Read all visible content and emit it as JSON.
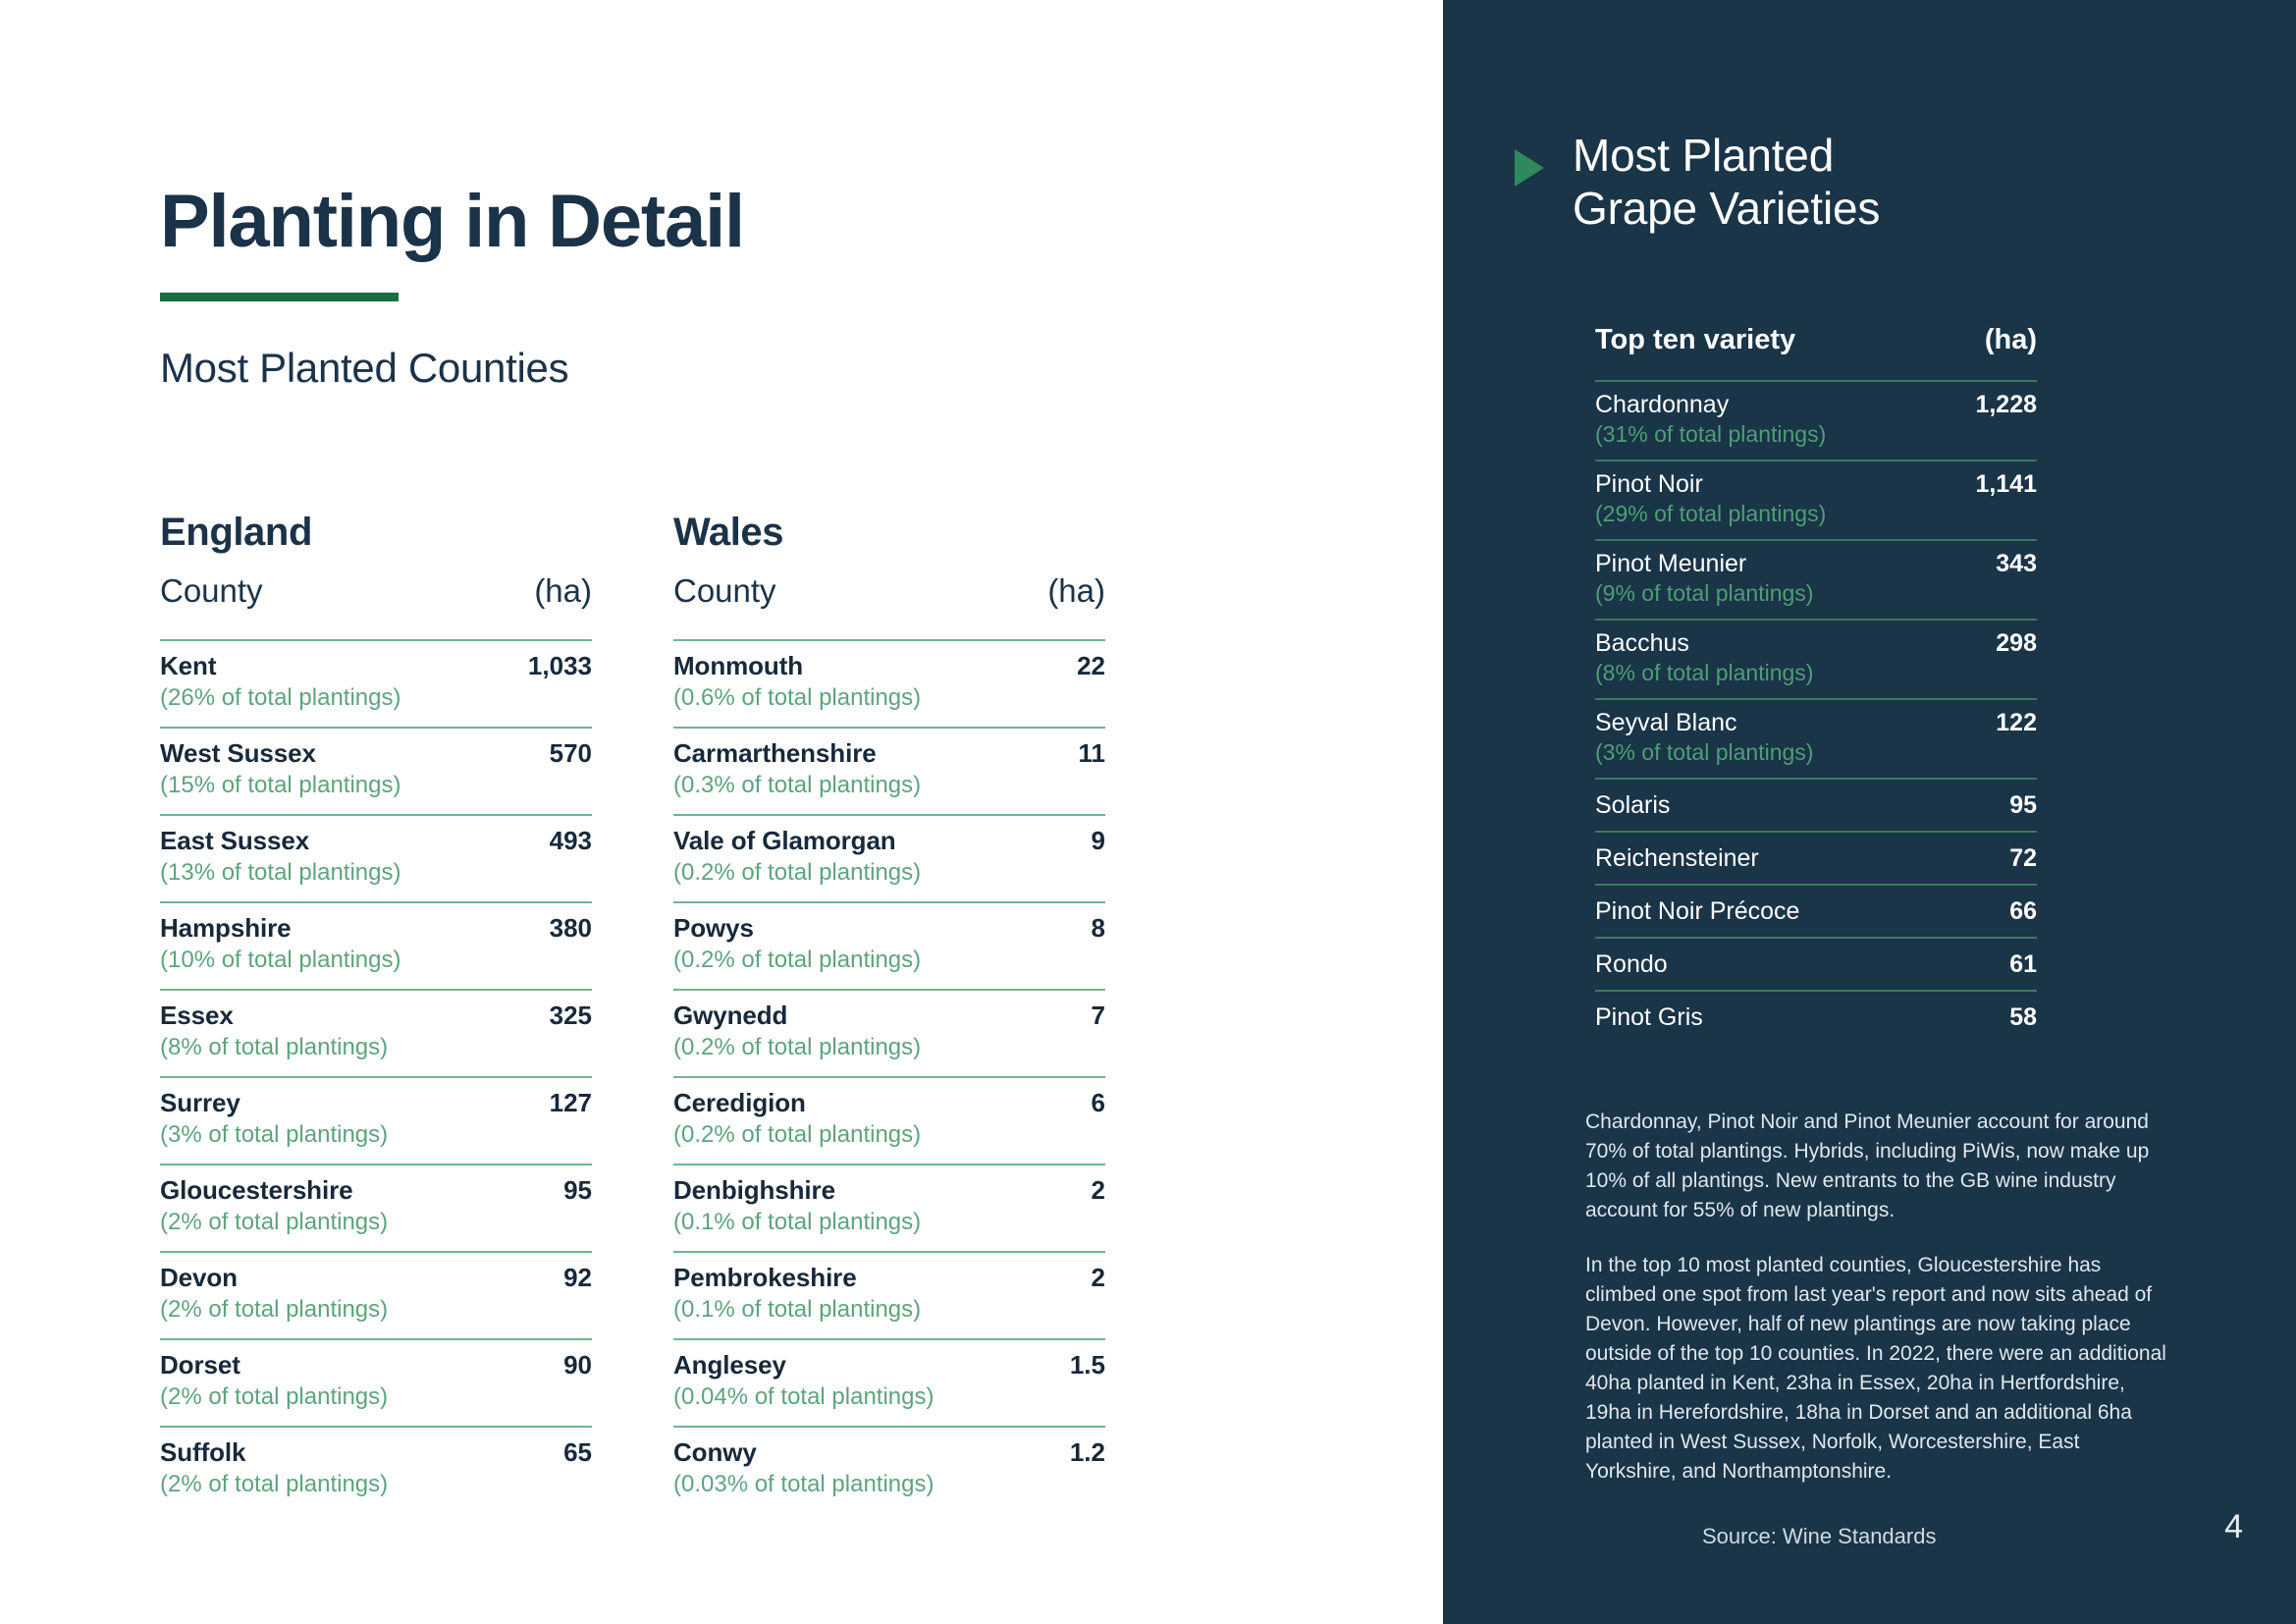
{
  "colors": {
    "dark_panel": "#1a3448",
    "accent_green": "#1d6b40",
    "triangle_green": "#2e8a5a",
    "rule_green_light": "#72b58d",
    "sub_text_green": "#5da47c",
    "navy_text": "#1b3349"
  },
  "left": {
    "title": "Planting in Detail",
    "subtitle": "Most Planted Counties",
    "tables": [
      {
        "country": "England",
        "header": {
          "label": "County",
          "unit": "(ha)"
        },
        "rows": [
          {
            "name": "Kent",
            "value": "1,033",
            "sub": "(26% of total plantings)"
          },
          {
            "name": "West Sussex",
            "value": "570",
            "sub": "(15% of total plantings)"
          },
          {
            "name": "East Sussex",
            "value": "493",
            "sub": "(13% of total plantings)"
          },
          {
            "name": "Hampshire",
            "value": "380",
            "sub": "(10% of total plantings)"
          },
          {
            "name": "Essex",
            "value": "325",
            "sub": "(8% of total plantings)"
          },
          {
            "name": "Surrey",
            "value": "127",
            "sub": "(3% of total plantings)"
          },
          {
            "name": "Gloucestershire",
            "value": "95",
            "sub": "(2% of total plantings)"
          },
          {
            "name": "Devon",
            "value": "92",
            "sub": "(2% of total plantings)"
          },
          {
            "name": "Dorset",
            "value": "90",
            "sub": "(2% of total plantings)"
          },
          {
            "name": "Suffolk",
            "value": "65",
            "sub": "(2% of total plantings)"
          }
        ]
      },
      {
        "country": "Wales",
        "header": {
          "label": "County",
          "unit": "(ha)"
        },
        "rows": [
          {
            "name": "Monmouth",
            "value": "22",
            "sub": "(0.6% of total plantings)"
          },
          {
            "name": "Carmarthenshire",
            "value": "11",
            "sub": "(0.3% of total plantings)"
          },
          {
            "name": "Vale of Glamorgan",
            "value": "9",
            "sub": "(0.2% of total plantings)"
          },
          {
            "name": "Powys",
            "value": "8",
            "sub": "(0.2% of total plantings)"
          },
          {
            "name": "Gwynedd",
            "value": "7",
            "sub": "(0.2% of total plantings)"
          },
          {
            "name": "Ceredigion",
            "value": "6",
            "sub": "(0.2% of total plantings)"
          },
          {
            "name": "Denbighshire",
            "value": "2",
            "sub": "(0.1% of total plantings)"
          },
          {
            "name": "Pembrokeshire",
            "value": "2",
            "sub": "(0.1% of total plantings)"
          },
          {
            "name": "Anglesey",
            "value": "1.5",
            "sub": "(0.04% of total plantings)"
          },
          {
            "name": "Conwy",
            "value": "1.2",
            "sub": "(0.03% of total plantings)"
          }
        ]
      }
    ]
  },
  "right": {
    "panel_title_line1": "Most Planted",
    "panel_title_line2": "Grape Varieties",
    "marker_icon": "play-triangle-icon",
    "header": {
      "label": "Top ten variety",
      "unit": "(ha)"
    },
    "varieties": [
      {
        "name": "Chardonnay",
        "value": "1,228",
        "sub": "(31% of total plantings)"
      },
      {
        "name": "Pinot Noir",
        "value": "1,141",
        "sub": "(29% of total plantings)"
      },
      {
        "name": "Pinot Meunier",
        "value": "343",
        "sub": "(9% of total plantings)"
      },
      {
        "name": "Bacchus",
        "value": "298",
        "sub": "(8% of total plantings)"
      },
      {
        "name": "Seyval Blanc",
        "value": "122",
        "sub": "(3% of total plantings)"
      },
      {
        "name": "Solaris",
        "value": "95",
        "sub": ""
      },
      {
        "name": "Reichensteiner",
        "value": "72",
        "sub": ""
      },
      {
        "name": "Pinot Noir Précoce",
        "value": "66",
        "sub": ""
      },
      {
        "name": "Rondo",
        "value": "61",
        "sub": ""
      },
      {
        "name": "Pinot Gris",
        "value": "58",
        "sub": ""
      }
    ],
    "notes": [
      "Chardonnay, Pinot Noir and Pinot Meunier account for around 70% of total plantings. Hybrids, including PiWis, now make up 10% of all plantings. New entrants to the GB wine industry account for 55% of new plantings.",
      "In the top 10 most planted counties, Gloucestershire has climbed one spot from last year's report and now sits ahead of Devon. However, half of new plantings are now taking place outside of the top 10 counties. In 2022, there were an additional 40ha planted in Kent, 23ha in Essex, 20ha in Hertfordshire, 19ha in Herefordshire, 18ha in Dorset and an additional 6ha planted in West Sussex, Norfolk, Worcestershire, East Yorkshire, and Northamptonshire."
    ],
    "source": "Source: Wine Standards",
    "page_number": "4"
  },
  "chart_data": {
    "type": "table",
    "title": "Planting in Detail",
    "tables": [
      {
        "name": "Most Planted Counties — England",
        "columns": [
          "County",
          "(ha)",
          "% of total plantings"
        ],
        "rows": [
          [
            "Kent",
            1033,
            "26%"
          ],
          [
            "West Sussex",
            570,
            "15%"
          ],
          [
            "East Sussex",
            493,
            "13%"
          ],
          [
            "Hampshire",
            380,
            "10%"
          ],
          [
            "Essex",
            325,
            "8%"
          ],
          [
            "Surrey",
            127,
            "3%"
          ],
          [
            "Gloucestershire",
            95,
            "2%"
          ],
          [
            "Devon",
            92,
            "2%"
          ],
          [
            "Dorset",
            90,
            "2%"
          ],
          [
            "Suffolk",
            65,
            "2%"
          ]
        ]
      },
      {
        "name": "Most Planted Counties — Wales",
        "columns": [
          "County",
          "(ha)",
          "% of total plantings"
        ],
        "rows": [
          [
            "Monmouth",
            22,
            "0.6%"
          ],
          [
            "Carmarthenshire",
            11,
            "0.3%"
          ],
          [
            "Vale of Glamorgan",
            9,
            "0.2%"
          ],
          [
            "Powys",
            8,
            "0.2%"
          ],
          [
            "Gwynedd",
            7,
            "0.2%"
          ],
          [
            "Ceredigion",
            6,
            "0.2%"
          ],
          [
            "Denbighshire",
            2,
            "0.1%"
          ],
          [
            "Pembrokeshire",
            2,
            "0.1%"
          ],
          [
            "Anglesey",
            1.5,
            "0.04%"
          ],
          [
            "Conwy",
            1.2,
            "0.03%"
          ]
        ]
      },
      {
        "name": "Most Planted Grape Varieties — Top ten variety",
        "columns": [
          "Variety",
          "(ha)",
          "% of total plantings"
        ],
        "rows": [
          [
            "Chardonnay",
            1228,
            "31%"
          ],
          [
            "Pinot Noir",
            1141,
            "29%"
          ],
          [
            "Pinot Meunier",
            343,
            "9%"
          ],
          [
            "Bacchus",
            298,
            "8%"
          ],
          [
            "Seyval Blanc",
            122,
            "3%"
          ],
          [
            "Solaris",
            95,
            ""
          ],
          [
            "Reichensteiner",
            72,
            ""
          ],
          [
            "Pinot Noir Précoce",
            66,
            ""
          ],
          [
            "Rondo",
            61,
            ""
          ],
          [
            "Pinot Gris",
            58,
            ""
          ]
        ]
      }
    ]
  }
}
